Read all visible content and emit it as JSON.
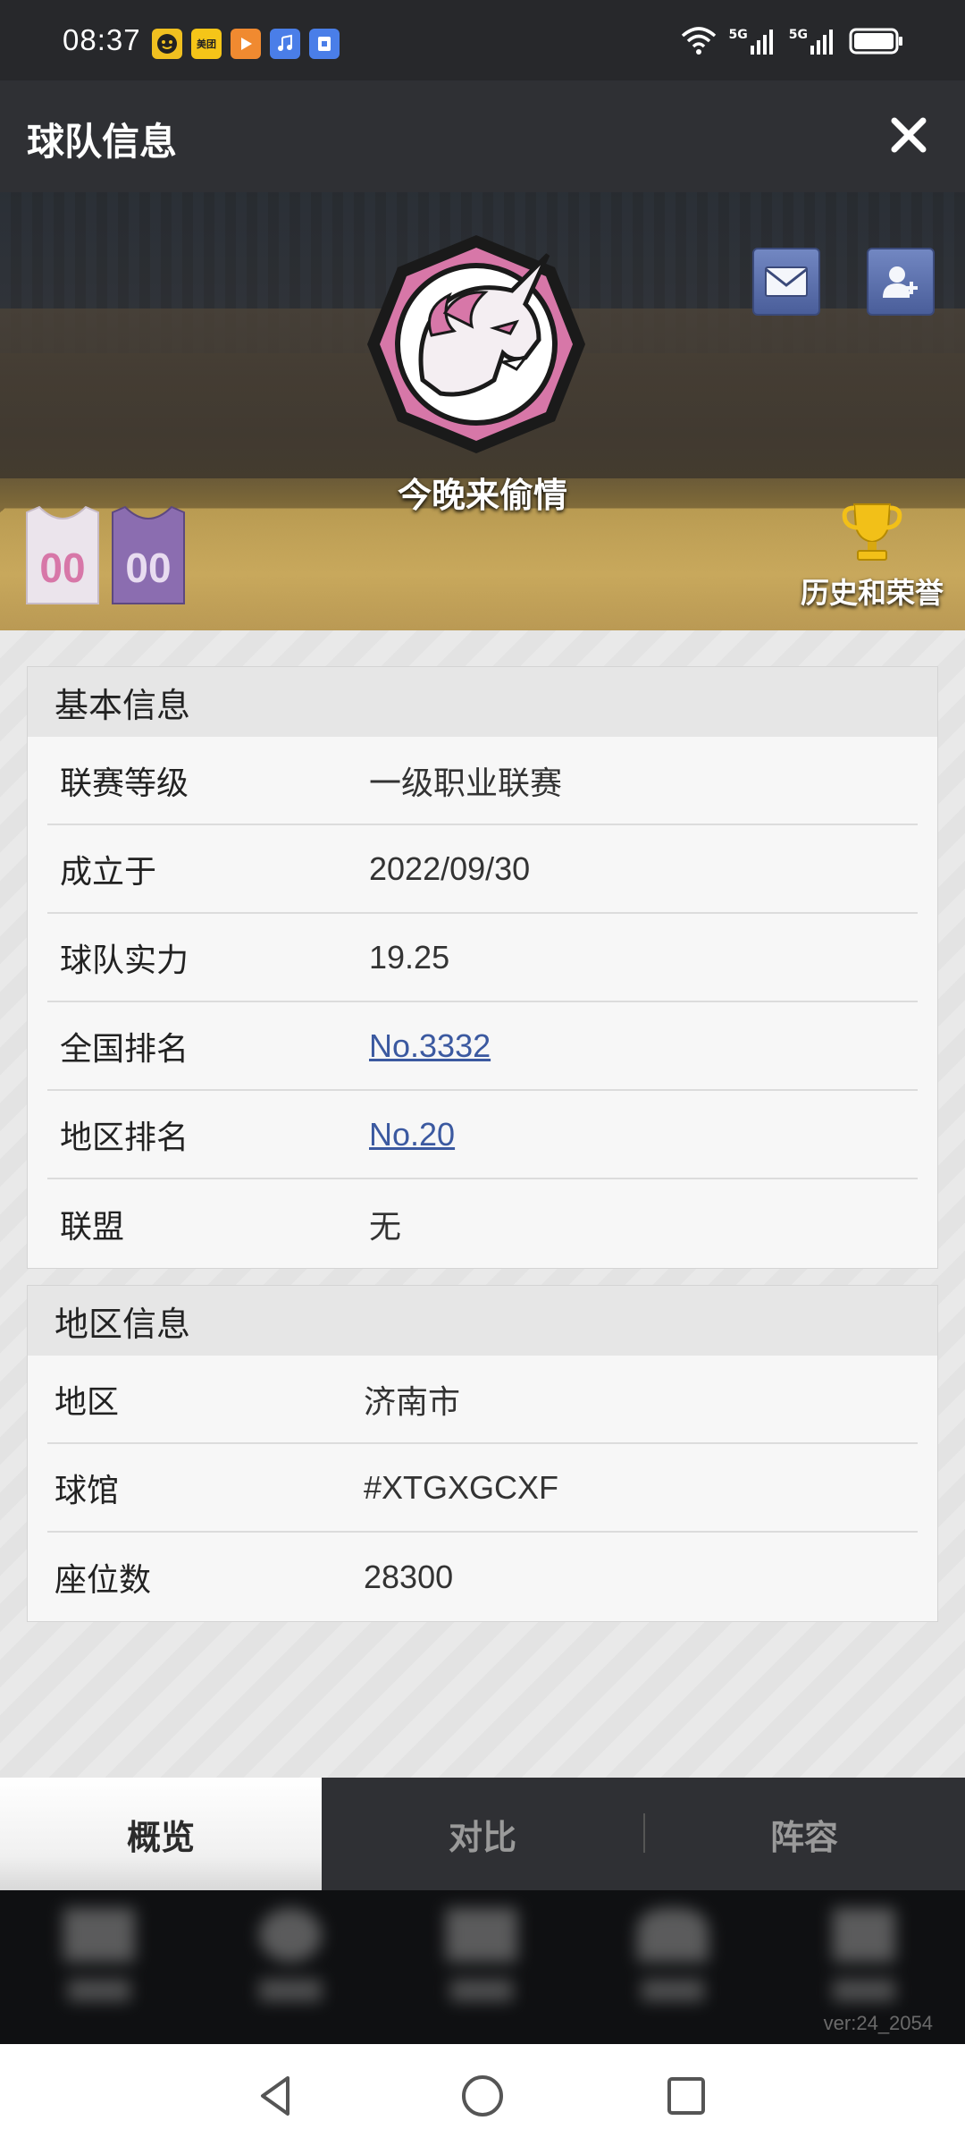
{
  "status_bar": {
    "time": "08:37",
    "notifications": [
      {
        "icon": "smiley-app-icon",
        "color": "#f0c020",
        "text": ""
      },
      {
        "icon": "meituan-app-icon",
        "color": "#f5c518",
        "text": "美团"
      },
      {
        "icon": "video-app-icon",
        "color": "#f08a30",
        "text": ""
      },
      {
        "icon": "music-app-icon",
        "color": "#4a7ee8",
        "text": ""
      },
      {
        "icon": "shield-app-icon",
        "color": "#4a7ee8",
        "text": ""
      }
    ],
    "network_1": "5G",
    "network_2": "5G"
  },
  "header": {
    "title": "球队信息"
  },
  "banner": {
    "team_name": "今晚来偷情",
    "jersey_home_number": "00",
    "jersey_away_number": "00",
    "honors_label": "历史和荣誉"
  },
  "basic_info": {
    "title": "基本信息",
    "rows": [
      {
        "label": "联赛等级",
        "value": "一级职业联赛"
      },
      {
        "label": "成立于",
        "value": "2022/09/30"
      },
      {
        "label": "球队实力",
        "value": "19.25"
      },
      {
        "label": "全国排名",
        "value": "No.3332"
      },
      {
        "label": "地区排名",
        "value": "No.20"
      },
      {
        "label": "联盟",
        "value": "无"
      }
    ]
  },
  "region_info": {
    "title": "地区信息",
    "rows": [
      {
        "label": "地区",
        "value": "济南市"
      },
      {
        "label": "球馆",
        "value": "#XTGXGCXF"
      },
      {
        "label": "座位数",
        "value": "28300"
      }
    ]
  },
  "tabs": [
    {
      "label": "概览",
      "active": true
    },
    {
      "label": "对比",
      "active": false
    },
    {
      "label": "阵容",
      "active": false
    }
  ],
  "version": "ver:24_2054",
  "colors": {
    "link": "#3b59a0",
    "logo_pink": "#d777a8",
    "button_blue": "#5a6fae"
  }
}
